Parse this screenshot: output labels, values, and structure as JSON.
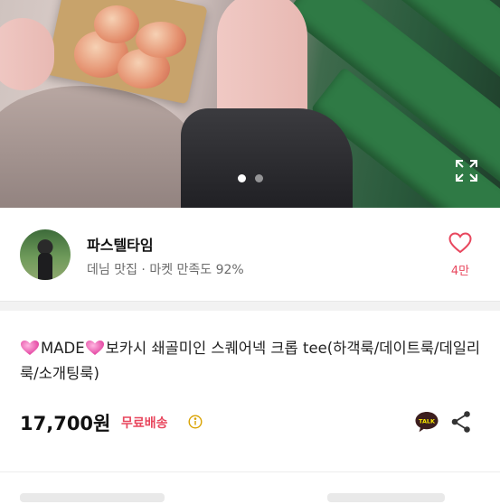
{
  "gallery": {
    "image_alt": "product-photo",
    "slide_count": 2,
    "active_slide": 1
  },
  "seller": {
    "name": "파스텔타임",
    "subtitle": "데님 맛집 · 마켓 만족도 92%"
  },
  "likes": {
    "count": "4만"
  },
  "product": {
    "title_part1": "MADE",
    "title_part2": "보카시 쇄골미인 스퀘어넥 크롭 tee(하객룩/데이트룩/데일리룩/소개팅룩)",
    "price": "17,700원",
    "shipping": "무료배송"
  },
  "colors": {
    "accent": "#e8475e",
    "divider": "#f2f2f2",
    "talk": "#3c1e1e"
  }
}
